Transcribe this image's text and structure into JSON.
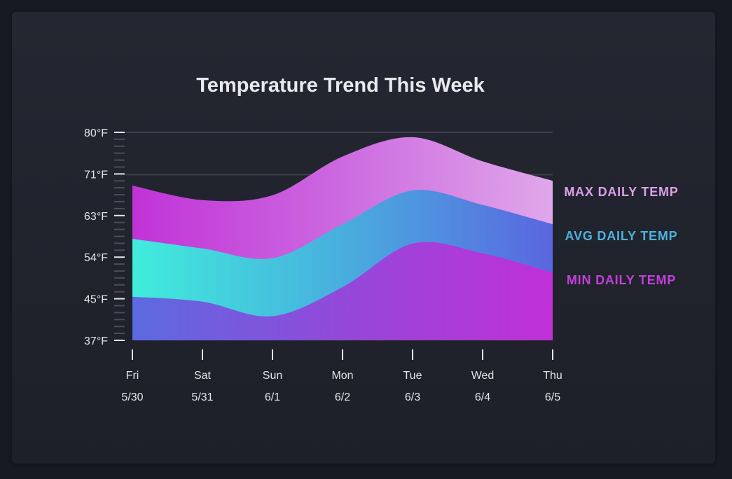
{
  "chart_data": {
    "type": "area",
    "title": "Temperature Trend This Week",
    "categories": [
      "Fri",
      "Sat",
      "Sun",
      "Mon",
      "Tue",
      "Wed",
      "Thu"
    ],
    "dates": [
      "5/30",
      "5/31",
      "6/1",
      "6/2",
      "6/3",
      "6/4",
      "6/5"
    ],
    "y_ticks": [
      "80°F",
      "71°F",
      "63°F",
      "54°F",
      "45°F",
      "37°F"
    ],
    "ylim": [
      37,
      80
    ],
    "series": [
      {
        "name": "MAX DAILY TEMP",
        "values": [
          69,
          66,
          67,
          75,
          79,
          74,
          70
        ],
        "color": "#dc9fe8"
      },
      {
        "name": "AVG DAILY TEMP",
        "values": [
          58,
          56,
          54,
          61,
          68,
          65,
          61
        ],
        "color": "#4eb1dc"
      },
      {
        "name": "MIN DAILY TEMP",
        "values": [
          46,
          45,
          42,
          48,
          57,
          55,
          51
        ],
        "color": "#c33fd9"
      }
    ],
    "grid": true,
    "legend": "right"
  }
}
